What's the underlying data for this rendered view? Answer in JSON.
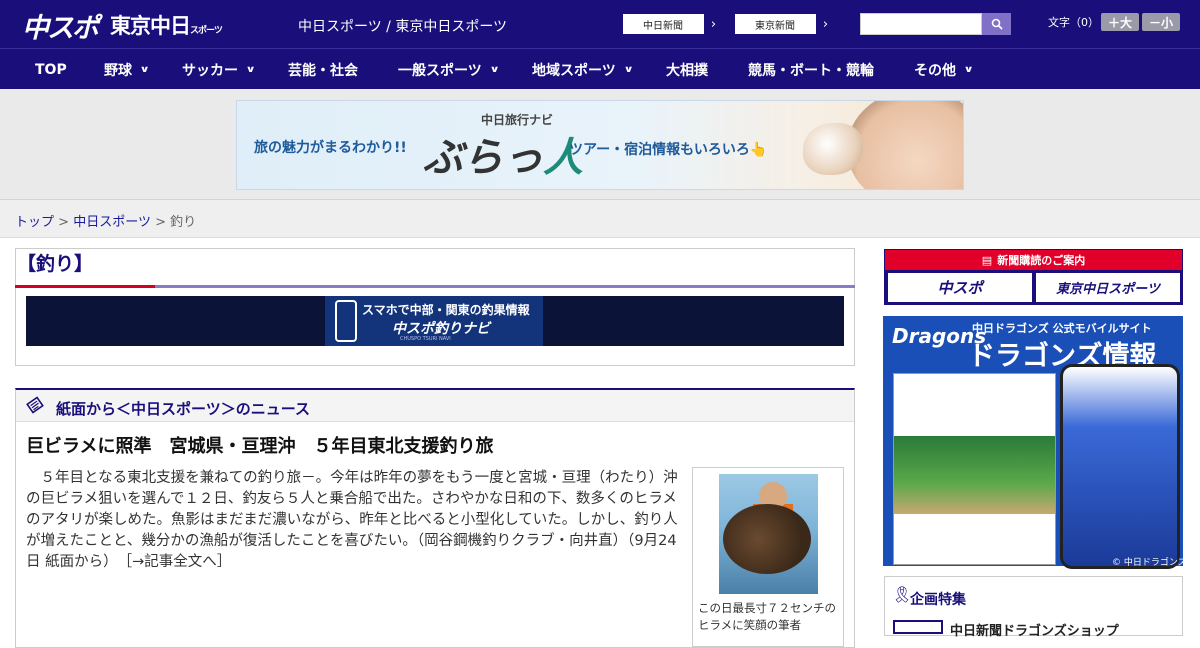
{
  "header": {
    "logo_main": "中スポ",
    "logo_tokyo": "東京中日",
    "logo_tokyo_small": "スポーツ",
    "tagline": "中日スポーツ / 東京中日スポーツ",
    "ext_links": [
      {
        "label": "中日新聞",
        "arrow": "›"
      },
      {
        "label": "東京新聞",
        "arrow": "›"
      }
    ],
    "search_icon": "search-icon",
    "font_size_label": "文字（0）",
    "font_bigger": "＋大",
    "font_smaller": "－小"
  },
  "nav": {
    "items": [
      {
        "label": "TOP",
        "chevron": ""
      },
      {
        "label": "野球",
        "chevron": "∨"
      },
      {
        "label": "サッカー",
        "chevron": "∨"
      },
      {
        "label": "芸能・社会",
        "chevron": ""
      },
      {
        "label": "一般スポーツ",
        "chevron": "∨"
      },
      {
        "label": "地域スポーツ",
        "chevron": "∨"
      },
      {
        "label": "大相撲",
        "chevron": ""
      },
      {
        "label": "競馬・ボート・競輪",
        "chevron": ""
      },
      {
        "label": "その他",
        "chevron": "∨"
      }
    ]
  },
  "ad": {
    "left_text": "旅の魅力がまるわかり!!",
    "brand_small": "中日旅行ナビ",
    "brand_big_a": "ぶらっ",
    "brand_big_b": "人",
    "right_text": "ツアー・宿泊情報もいろいろ👆"
  },
  "breadcrumb": {
    "items": [
      "トップ",
      "中日スポーツ",
      "釣り"
    ],
    "separator": ">"
  },
  "section": {
    "title": "【釣り】",
    "banner_line1": "スマホで中部・関東の釣果情報",
    "banner_line2": "中スポ釣りナビ",
    "banner_line3": "CHUSPO TSURI NAVI"
  },
  "news": {
    "heading": "紙面から＜中日スポーツ＞のニュース",
    "headline": "巨ビラメに照準　宮城県・亘理沖　５年目東北支援釣り旅",
    "body": "　５年目となる東北支援を兼ねての釣り旅－。今年は昨年の夢をもう一度と宮城・亘理（わたり）沖の巨ビラメ狙いを選んで１２日、釣友ら５人と乗合船で出た。さわやかな日和の下、数多くのヒラメのアタリが楽しめた。魚影はまだまだ濃いながら、昨年と比べると小型化していた。しかし、釣り人が増えたことと、幾分かの漁船が復活したことを喜びたい。（岡谷鋼機釣りクラブ・向井直）（9月24日 紙面から）",
    "more_link": "［→記事全文へ］",
    "caption": "この日最長寸７２センチのヒラメに笑顔の筆者"
  },
  "sidebar": {
    "subscribe_heading": "新聞購読のご案内",
    "subscribe_btn1": "中スポ",
    "subscribe_btn2": "東京中日スポーツ",
    "dragons_logo": "Dragons",
    "dragons_sub": "中日ドラゴンズ 公式モバイルサイト",
    "dragons_big": "ドラゴンズ情報",
    "dragons_copy": "© 中日ドラゴンズ",
    "kikaku_title": "企画特集",
    "kikaku_item": "中日新聞ドラゴンズショップ"
  },
  "colors": {
    "brand_navy": "#1a0f7a",
    "accent_red": "#d40024",
    "accent_lavender": "#8a7ac8"
  }
}
